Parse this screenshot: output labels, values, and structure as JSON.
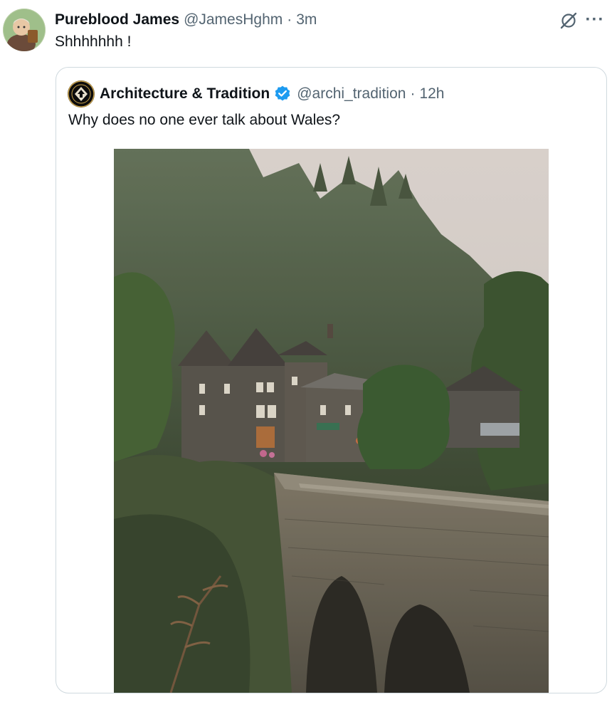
{
  "post": {
    "display_name": "Pureblood James",
    "handle": "@JamesHghm",
    "separator": "·",
    "time": "3m",
    "text": "Shhhhhhh !",
    "avatar_icon": "cartoon-avatar-icon"
  },
  "actions": {
    "grok_icon": "grok-icon",
    "more_label": "···"
  },
  "quoted_post": {
    "display_name": "Architecture & Tradition",
    "verified": true,
    "handle": "@archi_tradition",
    "separator": "·",
    "time": "12h",
    "text": "Why does no one ever talk about Wales?",
    "media_icon": "photo-stone-bridge-welsh-village"
  },
  "colors": {
    "text_primary": "#0f1419",
    "text_secondary": "#536471",
    "verified_blue": "#1d9bf0",
    "card_border": "#cfd9de"
  }
}
